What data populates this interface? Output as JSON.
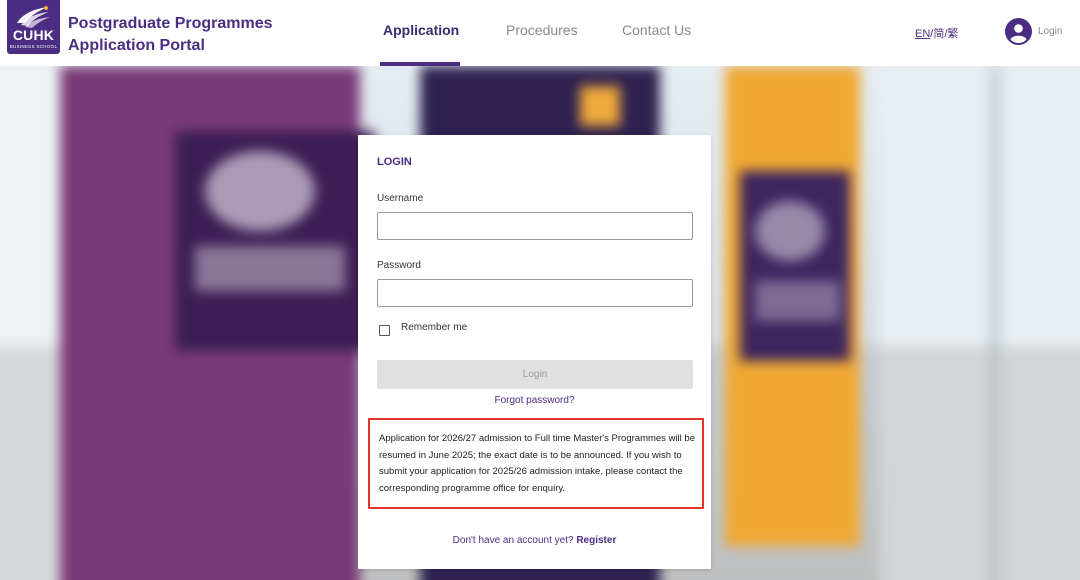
{
  "header": {
    "logo": {
      "text": "CUHK",
      "subtext": "BUSINESS SCHOOL",
      "brand_color": "#4b2e83"
    },
    "title_line1": "Postgraduate Programmes",
    "title_line2": "Application Portal",
    "nav": [
      {
        "label": "Application",
        "active": true
      },
      {
        "label": "Procedures",
        "active": false
      },
      {
        "label": "Contact Us",
        "active": false
      }
    ],
    "languages": [
      "EN",
      "简",
      "繁"
    ],
    "language_separator": "/",
    "user_icon": "user-avatar-icon",
    "login_label": "Login"
  },
  "login_card": {
    "title": "LOGIN",
    "username_label": "Username",
    "username_value": "",
    "password_label": "Password",
    "password_value": "",
    "remember_label": "Remember me",
    "remember_checked": false,
    "login_button": "Login",
    "forgot_password": "Forgot password?",
    "notice": "Application for 2026/27 admission to Full time Master's Programmes will be resumed in June 2025; the exact date is to be announced. If you wish to submit your application for 2025/26 admission intake, please contact the corresponding programme office for enquiry.",
    "notice_border_color": "#e1372f",
    "register_prompt": "Don't have an account yet?",
    "register_link": "Register"
  }
}
